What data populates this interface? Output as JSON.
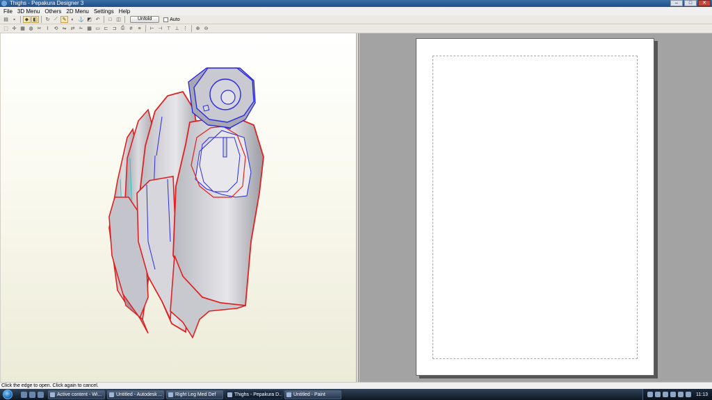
{
  "window": {
    "title": "Thighs - Pepakura Designer 3",
    "minimize": "–",
    "maximize": "□",
    "close": "✕"
  },
  "menu": [
    "File",
    "3D Menu",
    "Others",
    "2D Menu",
    "Settings",
    "Help"
  ],
  "toolbar": {
    "unfold_label": "Unfold",
    "auto_label": "Auto",
    "auto_checked": false
  },
  "status": {
    "message": "Click the edge to open. Click again to cancel."
  },
  "taskbar": {
    "tasks": [
      {
        "label": "Active content - Wi...",
        "active": false
      },
      {
        "label": "Untitled - Autodesk ...",
        "active": false
      },
      {
        "label": "Right Leg Med Def",
        "active": false
      },
      {
        "label": "Thighs - Pepakura D...",
        "active": true
      },
      {
        "label": "Untitled - Paint",
        "active": false
      }
    ],
    "clock": "11:13"
  },
  "colors": {
    "fold_edge": "#e02020",
    "mountain_edge": "#2a2ae0",
    "cut_edge": "#20c8c8",
    "model_fill": "#cfcfd4"
  }
}
